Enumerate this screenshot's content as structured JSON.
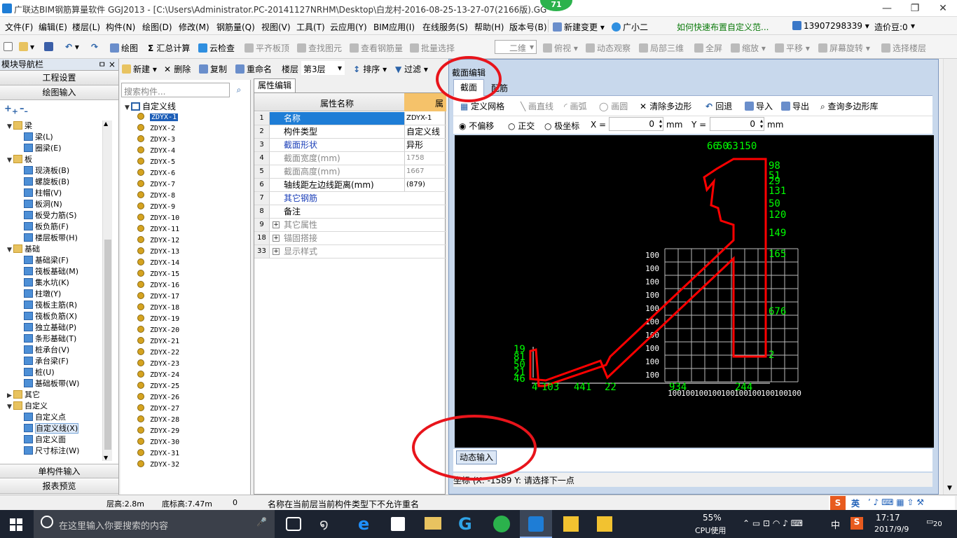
{
  "title": "广联达BIM钢筋算量软件 GGJ2013 - [C:\\Users\\Administrator.PC-20141127NRHM\\Desktop\\白龙村-2016-08-25-13-27-07(2166版).GG",
  "badge": "71",
  "window_controls": [
    "—",
    "❐",
    "✕"
  ],
  "menu": [
    "文件(F)",
    "编辑(E)",
    "楼层(L)",
    "构件(N)",
    "绘图(D)",
    "修改(M)",
    "钢筋量(Q)",
    "视图(V)",
    "工具(T)",
    "云应用(Y)",
    "BIM应用(I)",
    "在线服务(S)",
    "帮助(H)",
    "版本号(B)"
  ],
  "menu_right": {
    "new_change": "新建变更",
    "assistant": "广小二",
    "tip": "如何快速布置自定义范...",
    "phone": "13907298339",
    "price": "造价豆:0"
  },
  "toolbar": {
    "draw": "绘图",
    "sum": "汇总计算",
    "cloud_check": "云检查",
    "flat_top": "平齐板顶",
    "find_elem": "查找图元",
    "view_rebar": "查看钢筋量",
    "batch_select": "批量选择",
    "view_mode": "二维",
    "top_view": "俯视",
    "dyn_view": "动态观察",
    "local_3d": "局部三维",
    "fullscreen": "全屏",
    "zoom": "缩放",
    "pan": "平移",
    "screen_rotate": "屏幕旋转",
    "select_floor": "选择楼层"
  },
  "left": {
    "header": "模块导航栏",
    "pin": "ㅁ ×",
    "btn_settings": "工程设置",
    "btn_draw_input": "绘图输入",
    "btn_single_input": "单构件输入",
    "btn_report": "报表预览",
    "tree": [
      {
        "label": "梁",
        "level": 0,
        "expanded": true
      },
      {
        "label": "梁(L)",
        "level": 1
      },
      {
        "label": "圈梁(E)",
        "level": 1
      },
      {
        "label": "板",
        "level": 0,
        "expanded": true
      },
      {
        "label": "现浇板(B)",
        "level": 1
      },
      {
        "label": "螺旋板(B)",
        "level": 1
      },
      {
        "label": "柱帽(V)",
        "level": 1
      },
      {
        "label": "板洞(N)",
        "level": 1
      },
      {
        "label": "板受力筋(S)",
        "level": 1
      },
      {
        "label": "板负筋(F)",
        "level": 1
      },
      {
        "label": "楼层板带(H)",
        "level": 1
      },
      {
        "label": "基础",
        "level": 0,
        "expanded": true
      },
      {
        "label": "基础梁(F)",
        "level": 1
      },
      {
        "label": "筏板基础(M)",
        "level": 1
      },
      {
        "label": "集水坑(K)",
        "level": 1
      },
      {
        "label": "柱墩(Y)",
        "level": 1
      },
      {
        "label": "筏板主筋(R)",
        "level": 1
      },
      {
        "label": "筏板负筋(X)",
        "level": 1
      },
      {
        "label": "独立基础(P)",
        "level": 1
      },
      {
        "label": "条形基础(T)",
        "level": 1
      },
      {
        "label": "桩承台(V)",
        "level": 1
      },
      {
        "label": "承台梁(F)",
        "level": 1
      },
      {
        "label": "桩(U)",
        "level": 1
      },
      {
        "label": "基础板带(W)",
        "level": 1
      },
      {
        "label": "其它",
        "level": 0,
        "expanded": false
      },
      {
        "label": "自定义",
        "level": 0,
        "expanded": true
      },
      {
        "label": "自定义点",
        "level": 1
      },
      {
        "label": "自定义线(X)",
        "level": 1,
        "selected": true
      },
      {
        "label": "自定义面",
        "level": 1
      },
      {
        "label": "尺寸标注(W)",
        "level": 1
      }
    ]
  },
  "comp_toolbar": {
    "new": "新建",
    "delete": "删除",
    "copy": "复制",
    "rename": "重命名",
    "floor_label": "楼层",
    "floor": "第3层",
    "sort": "排序",
    "filter": "过滤"
  },
  "comp": {
    "search_placeholder": "搜索构件...",
    "root": "自定义线",
    "items": [
      "ZDYX-1",
      "ZDYX-2",
      "ZDYX-3",
      "ZDYX-4",
      "ZDYX-5",
      "ZDYX-6",
      "ZDYX-7",
      "ZDYX-8",
      "ZDYX-9",
      "ZDYX-10",
      "ZDYX-11",
      "ZDYX-12",
      "ZDYX-13",
      "ZDYX-14",
      "ZDYX-15",
      "ZDYX-16",
      "ZDYX-17",
      "ZDYX-18",
      "ZDYX-19",
      "ZDYX-20",
      "ZDYX-21",
      "ZDYX-22",
      "ZDYX-23",
      "ZDYX-24",
      "ZDYX-25",
      "ZDYX-26",
      "ZDYX-27",
      "ZDYX-28",
      "ZDYX-29",
      "ZDYX-30",
      "ZDYX-31",
      "ZDYX-32"
    ]
  },
  "props": {
    "tab": "属性编辑",
    "col_name": "属性名称",
    "col_value": "属",
    "rows": [
      {
        "n": "1",
        "k": "名称",
        "v": "ZDYX-1",
        "style": "selected"
      },
      {
        "n": "2",
        "k": "构件类型",
        "v": "自定义线",
        "style": "normal"
      },
      {
        "n": "3",
        "k": "截面形状",
        "v": "异形",
        "style": "blue"
      },
      {
        "n": "4",
        "k": "截面宽度(mm)",
        "v": "1758",
        "style": "gray"
      },
      {
        "n": "5",
        "k": "截面高度(mm)",
        "v": "1667",
        "style": "gray"
      },
      {
        "n": "6",
        "k": "轴线距左边线距离(mm)",
        "v": "(879)",
        "style": "normal"
      },
      {
        "n": "7",
        "k": "其它钢筋",
        "v": "",
        "style": "blue"
      },
      {
        "n": "8",
        "k": "备注",
        "v": "",
        "style": "normal"
      },
      {
        "n": "9",
        "k": "其它属性",
        "v": "",
        "style": "group"
      },
      {
        "n": "18",
        "k": "锚固搭接",
        "v": "",
        "style": "group"
      },
      {
        "n": "33",
        "k": "显示样式",
        "v": "",
        "style": "group"
      }
    ]
  },
  "dialog": {
    "title": "截面编辑",
    "tabs": [
      "截面",
      "配筋"
    ],
    "tools": {
      "define_grid": "定义网格",
      "draw_line": "画直线",
      "draw_arc": "画弧",
      "draw_circle": "画圆",
      "clear_poly": "清除多边形",
      "undo": "回退",
      "import": "导入",
      "export": "导出",
      "query_lib": "查询多边形库"
    },
    "opts": {
      "no_offset": "不偏移",
      "ortho": "正交",
      "polar": "极坐标",
      "x_label": "X =",
      "x_val": "0",
      "unit1": "mm",
      "y_label": "Y =",
      "y_val": "0",
      "unit2": "mm"
    },
    "dyn_input": "动态输入",
    "coord": "坐标 (X: -1589 Y:  请选择下一点"
  },
  "dims": {
    "top": [
      "66",
      "50",
      "63",
      "150"
    ],
    "right": [
      "98",
      "51",
      "29",
      "131",
      "50",
      "120",
      "149",
      "165",
      "676",
      "2"
    ],
    "left": [
      "19",
      "81",
      "50",
      "21",
      "46"
    ],
    "bottom": [
      "4",
      "103",
      "441",
      "22",
      "934",
      "244"
    ],
    "grid_row": "100",
    "grid_col": "100"
  },
  "status": {
    "floor_h": "层高:2.8m",
    "base_h": "底标高:7.47m",
    "zero": "0",
    "msg": "名称在当前层当前构件类型下不允许重名"
  },
  "taskbar": {
    "search": "在这里输入你要搜索的内容",
    "cpu_pct": "55%",
    "cpu_label": "CPU使用",
    "ime": "中",
    "time": "17:17",
    "date": "2017/9/9",
    "notif": "20"
  },
  "tray": {
    "ime_en": "英"
  },
  "colors": {
    "accent": "#1e7dd6",
    "shape": "#ff0000",
    "dim": "#00ff00",
    "circle": "#e8141b"
  }
}
